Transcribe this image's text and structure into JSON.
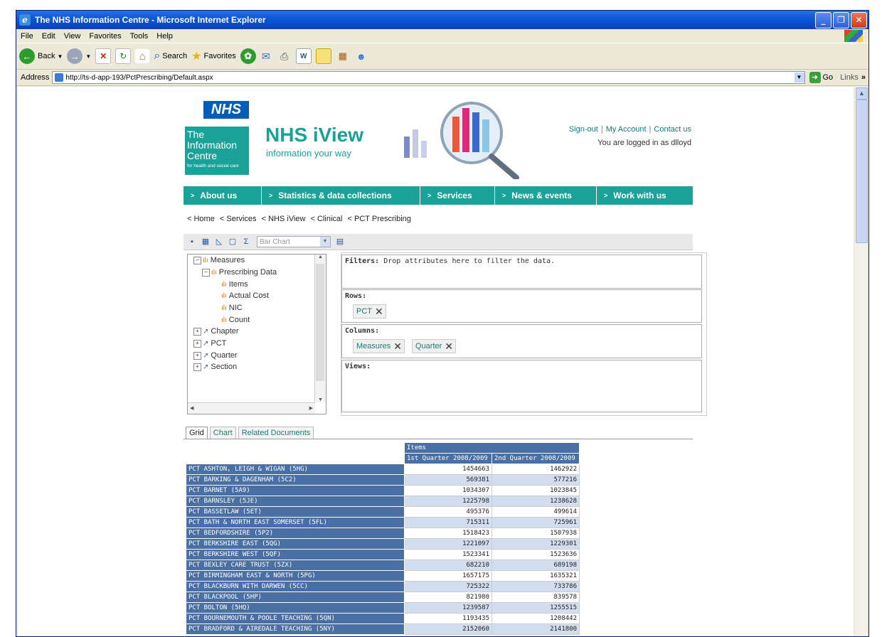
{
  "window": {
    "title": "The NHS Information Centre - Microsoft Internet Explorer"
  },
  "menu": [
    "File",
    "Edit",
    "View",
    "Favorites",
    "Tools",
    "Help"
  ],
  "toolbar": {
    "back": "Back",
    "search": "Search",
    "favorites": "Favorites"
  },
  "address": {
    "label": "Address",
    "url": "http://ts-d-app-193/PctPrescribing/Default.aspx",
    "go": "Go",
    "links": "Links"
  },
  "site": {
    "nhs": "NHS",
    "ic_line1": "The",
    "ic_line2": "Information",
    "ic_line3": "Centre",
    "ic_sub": "for health and social care",
    "title": "NHS iView",
    "tagline": "information your way",
    "links": {
      "signout": "Sign-out",
      "account": "My Account",
      "contact": "Contact us"
    },
    "logged_in": "You are logged in as dlloyd"
  },
  "nav": [
    "About us",
    "Statistics & data collections",
    "Services",
    "News & events",
    "Work with us"
  ],
  "breadcrumb": [
    "< Home",
    "< Services",
    "< NHS iView",
    "< Clinical",
    "< PCT Prescribing"
  ],
  "cube": {
    "chart_type": "Bar Chart"
  },
  "tree": {
    "measures": "Measures",
    "prescribing": "Prescribing Data",
    "items": "Items",
    "actual_cost": "Actual Cost",
    "nic": "NIC",
    "count": "Count",
    "chapter": "Chapter",
    "pct": "PCT",
    "quarter": "Quarter",
    "section": "Section"
  },
  "zones": {
    "filters_label": "Filters:",
    "filters_hint": "Drop attributes here to filter the data.",
    "rows_label": "Rows:",
    "rows_chip": "PCT",
    "columns_label": "Columns:",
    "columns_chip1": "Measures",
    "columns_chip2": "Quarter",
    "views_label": "Views:"
  },
  "tabs": [
    "Grid",
    "Chart",
    "Related Documents"
  ],
  "grid": {
    "measure": "Items",
    "q1": "1st Quarter 2008/2009",
    "q2": "2nd Quarter 2008/2009",
    "rows": [
      [
        "PCT ASHTON, LEIGH & WIGAN (5HG)",
        "1454663",
        "1462922"
      ],
      [
        "PCT BARKING & DAGENHAM (5C2)",
        "569381",
        "577216"
      ],
      [
        "PCT BARNET (5A9)",
        "1034307",
        "1023845"
      ],
      [
        "PCT BARNSLEY (5JE)",
        "1225798",
        "1238628"
      ],
      [
        "PCT BASSETLAW (5ET)",
        "495376",
        "499614"
      ],
      [
        "PCT BATH & NORTH EAST SOMERSET (5FL)",
        "715311",
        "725961"
      ],
      [
        "PCT BEDFORDSHIRE (5P2)",
        "1518423",
        "1507938"
      ],
      [
        "PCT BERKSHIRE EAST (5QG)",
        "1221097",
        "1229301"
      ],
      [
        "PCT BERKSHIRE WEST (5QF)",
        "1523341",
        "1523636"
      ],
      [
        "PCT BEXLEY CARE TRUST (5ZX)",
        "682210",
        "689198"
      ],
      [
        "PCT BIRMINGHAM EAST & NORTH (5PG)",
        "1657175",
        "1635321"
      ],
      [
        "PCT BLACKBURN WITH DARWEN (5CC)",
        "725322",
        "733786"
      ],
      [
        "PCT BLACKPOOL (5HP)",
        "821980",
        "839578"
      ],
      [
        "PCT BOLTON (5HQ)",
        "1239587",
        "1255515"
      ],
      [
        "PCT BOURNEMOUTH & POOLE TEACHING (5QN)",
        "1193435",
        "1208442"
      ],
      [
        "PCT BRADFORD & AIREDALE TEACHING (5NY)",
        "2152060",
        "2141800"
      ]
    ]
  }
}
